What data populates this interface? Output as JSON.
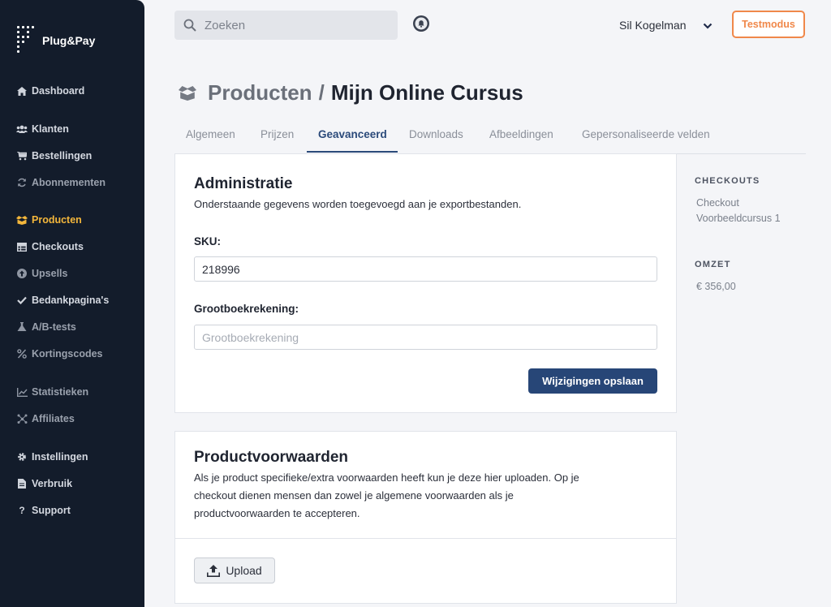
{
  "app": {
    "name": "Plug&Pay"
  },
  "sidebar": {
    "items": [
      {
        "label": "Dashboard",
        "icon": "home-icon"
      },
      {
        "label": "Klanten",
        "icon": "users-icon"
      },
      {
        "label": "Bestellingen",
        "icon": "cart-icon"
      },
      {
        "label": "Abonnementen",
        "icon": "refresh-icon"
      },
      {
        "label": "Producten",
        "icon": "box-icon",
        "active": true
      },
      {
        "label": "Checkouts",
        "icon": "table-icon"
      },
      {
        "label": "Upsells",
        "icon": "arrow-circle-icon"
      },
      {
        "label": "Bedankpagina's",
        "icon": "check-icon"
      },
      {
        "label": "A/B-tests",
        "icon": "flask-icon"
      },
      {
        "label": "Kortingscodes",
        "icon": "percent-icon"
      },
      {
        "label": "Statistieken",
        "icon": "chart-icon"
      },
      {
        "label": "Affiliates",
        "icon": "network-icon"
      },
      {
        "label": "Instellingen",
        "icon": "gear-icon"
      },
      {
        "label": "Verbruik",
        "icon": "file-icon"
      },
      {
        "label": "Support",
        "icon": "question-icon"
      }
    ]
  },
  "topbar": {
    "search_placeholder": "Zoeken",
    "user_name": "Sil Kogelman",
    "test_mode_label": "Testmodus"
  },
  "page": {
    "breadcrumb_parent": "Producten",
    "breadcrumb_sep": "/",
    "title": "Mijn Online Cursus"
  },
  "tabs": [
    {
      "label": "Algemeen"
    },
    {
      "label": "Prijzen"
    },
    {
      "label": "Geavanceerd",
      "active": true
    },
    {
      "label": "Downloads"
    },
    {
      "label": "Afbeeldingen"
    },
    {
      "label": "Gepersonaliseerde velden"
    }
  ],
  "administratie": {
    "title": "Administratie",
    "description": "Onderstaande gegevens worden toegevoegd aan je exportbestanden.",
    "sku_label": "SKU:",
    "sku_value": "218996",
    "ledger_label": "Grootboekrekening:",
    "ledger_placeholder": "Grootboekrekening",
    "save_label": "Wijzigingen opslaan"
  },
  "voorwaarden": {
    "title": "Productvoorwaarden",
    "description_lines": [
      "Als je product specifieke/extra voorwaarden heeft kun je deze hier uploaden. Op je",
      "checkout dienen mensen dan zowel je algemene voorwaarden als je",
      "productvoorwaarden te accepteren."
    ],
    "upload_label": "Upload"
  },
  "right": {
    "checkouts_heading": "CHECKOUTS",
    "checkout_lines": [
      "Checkout",
      "Voorbeeldcursus 1"
    ],
    "omzet_heading": "OMZET",
    "omzet_value": "€ 356,00"
  },
  "colors": {
    "sidebar_bg": "#131c2b",
    "active_accent": "#f3b63b",
    "primary_button": "#274677",
    "test_mode_orange": "#f0884a"
  }
}
